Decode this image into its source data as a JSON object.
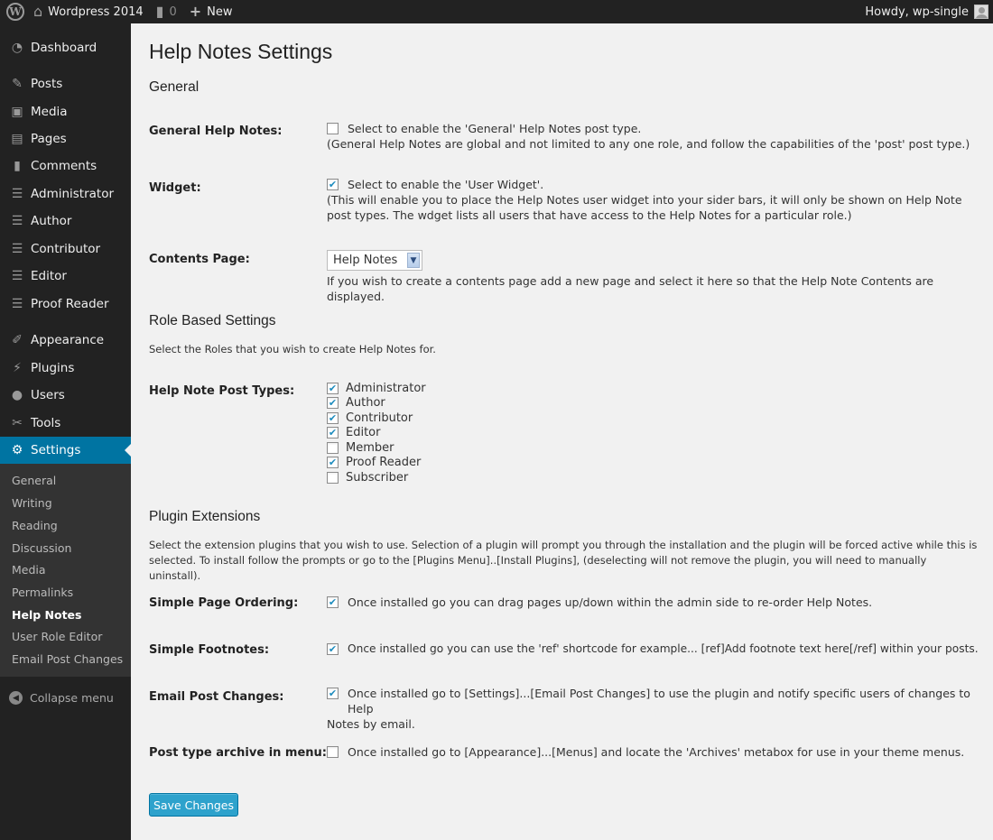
{
  "adminbar": {
    "site_name": "Wordpress 2014",
    "comments_count": "0",
    "new_label": "New",
    "howdy": "Howdy, wp-single"
  },
  "sidebar": {
    "items": [
      {
        "label": "Dashboard",
        "icon": "dashboard-icon"
      },
      {
        "label": "Posts",
        "icon": "pin-icon"
      },
      {
        "label": "Media",
        "icon": "media-icon"
      },
      {
        "label": "Pages",
        "icon": "pages-icon"
      },
      {
        "label": "Comments",
        "icon": "comment-icon"
      },
      {
        "label": "Administrator",
        "icon": "note-icon"
      },
      {
        "label": "Author",
        "icon": "note-icon"
      },
      {
        "label": "Contributor",
        "icon": "note-icon"
      },
      {
        "label": "Editor",
        "icon": "note-icon"
      },
      {
        "label": "Proof Reader",
        "icon": "note-icon"
      },
      {
        "label": "Appearance",
        "icon": "brush-icon"
      },
      {
        "label": "Plugins",
        "icon": "plug-icon"
      },
      {
        "label": "Users",
        "icon": "user-icon"
      },
      {
        "label": "Tools",
        "icon": "wrench-icon"
      },
      {
        "label": "Settings",
        "icon": "settings-icon"
      }
    ],
    "submenu": [
      "General",
      "Writing",
      "Reading",
      "Discussion",
      "Media",
      "Permalinks",
      "Help Notes",
      "User Role Editor",
      "Email Post Changes"
    ],
    "current_submenu": "Help Notes",
    "collapse_label": "Collapse menu"
  },
  "page": {
    "title": "Help Notes Settings",
    "general": {
      "heading": "General",
      "general_help_notes": {
        "label": "General Help Notes:",
        "checked": false,
        "text": "Select to enable the 'General' Help Notes post type.",
        "desc": "(General Help Notes are global and not limited to any one role, and follow the capabilities of the 'post' post type.)"
      },
      "widget": {
        "label": "Widget:",
        "checked": true,
        "text": "Select to enable the 'User Widget'.",
        "desc": "(This will enable you to place the Help Notes user widget into your sider bars, it will only be shown on Help Note post types. The wdget lists all users that have access to the Help Notes for a particular role.)"
      },
      "contents_page": {
        "label": "Contents Page:",
        "selected": "Help Notes",
        "desc": "If you wish to create a contents page add a new page and select it here so that the Help Note Contents are displayed."
      }
    },
    "roles": {
      "heading": "Role Based Settings",
      "intro": "Select the Roles that you wish to create Help Notes for.",
      "label": "Help Note Post Types:",
      "items": [
        {
          "name": "Administrator",
          "checked": true
        },
        {
          "name": "Author",
          "checked": true
        },
        {
          "name": "Contributor",
          "checked": true
        },
        {
          "name": "Editor",
          "checked": true
        },
        {
          "name": "Member",
          "checked": false
        },
        {
          "name": "Proof Reader",
          "checked": true
        },
        {
          "name": "Subscriber",
          "checked": false
        }
      ]
    },
    "extensions": {
      "heading": "Plugin Extensions",
      "intro_1": "Select the extension plugins that you wish to use. Selection of a plugin will prompt you through the installation and the plugin will be forced active while this is",
      "intro_2": "selected. To install follow the prompts or go to the [Plugins Menu]..[Install Plugins], (deselecting will not remove the plugin, you will need to manually uninstall).",
      "items": [
        {
          "label": "Simple Page Ordering:",
          "checked": true,
          "text": "Once installed go you can drag pages up/down within the admin side to re-order Help Notes."
        },
        {
          "label": "Simple Footnotes:",
          "checked": true,
          "text": "Once installed go you can use the 'ref' shortcode for example... [ref]Add footnote text here[/ref] within your posts."
        },
        {
          "label": "Email Post Changes:",
          "checked": true,
          "text": "Once installed go to [Settings]...[Email Post Changes] to use the plugin and notify specific users of changes to Help",
          "text_2": "Notes by email."
        },
        {
          "label": "Post type archive in menu:",
          "checked": false,
          "text": "Once installed go to [Appearance]...[Menus] and locate the 'Archives' metabox for use in your theme menus."
        }
      ]
    },
    "save_label": "Save Changes"
  }
}
